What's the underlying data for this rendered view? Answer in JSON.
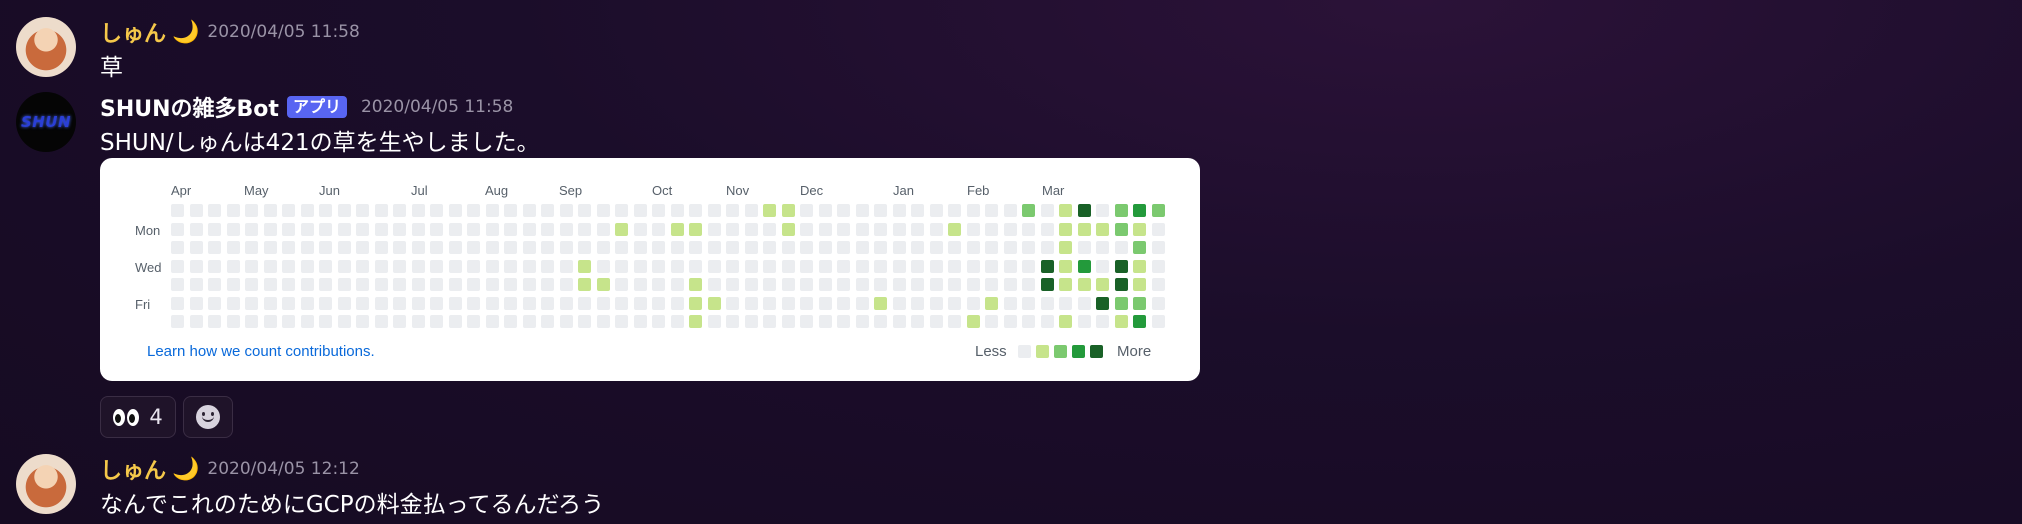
{
  "messages": [
    {
      "username": "しゅん",
      "moon": "🌙",
      "timestamp": "2020/04/05 11:58",
      "text": "草"
    },
    {
      "username": "SHUNの雑多Bot",
      "badge": "アプリ",
      "avatar_text": "SHUN",
      "timestamp": "2020/04/05 11:58",
      "text": "SHUN/しゅんは421の草を生やしました。"
    },
    {
      "username": "しゅん",
      "moon": "🌙",
      "timestamp": "2020/04/05 12:12",
      "text": "なんでこれのためにGCPの料金払ってるんだろう"
    }
  ],
  "contribution_graph": {
    "months": [
      "Apr",
      "May",
      "Jun",
      "Jul",
      "Aug",
      "Sep",
      "Oct",
      "Nov",
      "Dec",
      "Jan",
      "Feb",
      "Mar"
    ],
    "day_labels": [
      "Mon",
      "Wed",
      "Fri"
    ],
    "learn_link": "Learn how we count contributions.",
    "legend_less": "Less",
    "legend_more": "More",
    "colors": [
      "#ebedf0",
      "#c6e48b",
      "#7bc96f",
      "#239a3b",
      "#196127"
    ],
    "levels": [
      [
        0,
        0,
        0,
        0,
        0,
        0,
        0,
        0,
        0,
        0,
        0,
        0,
        0,
        0,
        0,
        0,
        0,
        0,
        0,
        0,
        0,
        0,
        0,
        0,
        0,
        0,
        0,
        0,
        0,
        0,
        0,
        0,
        1,
        1,
        0,
        0,
        0,
        0,
        0,
        0,
        0,
        0,
        0,
        0,
        0,
        0,
        2,
        0,
        1,
        4,
        0,
        2,
        3,
        2
      ],
      [
        0,
        0,
        0,
        0,
        0,
        0,
        0,
        0,
        0,
        0,
        0,
        0,
        0,
        0,
        0,
        0,
        0,
        0,
        0,
        0,
        0,
        0,
        0,
        0,
        1,
        0,
        0,
        1,
        1,
        0,
        0,
        0,
        0,
        1,
        0,
        0,
        0,
        0,
        0,
        0,
        0,
        0,
        1,
        0,
        0,
        0,
        0,
        0,
        1,
        1,
        1,
        2,
        1,
        0
      ],
      [
        0,
        0,
        0,
        0,
        0,
        0,
        0,
        0,
        0,
        0,
        0,
        0,
        0,
        0,
        0,
        0,
        0,
        0,
        0,
        0,
        0,
        0,
        0,
        0,
        0,
        0,
        0,
        0,
        0,
        0,
        0,
        0,
        0,
        0,
        0,
        0,
        0,
        0,
        0,
        0,
        0,
        0,
        0,
        0,
        0,
        0,
        0,
        0,
        1,
        0,
        0,
        0,
        2,
        0
      ],
      [
        0,
        0,
        0,
        0,
        0,
        0,
        0,
        0,
        0,
        0,
        0,
        0,
        0,
        0,
        0,
        0,
        0,
        0,
        0,
        0,
        0,
        0,
        1,
        0,
        0,
        0,
        0,
        0,
        0,
        0,
        0,
        0,
        0,
        0,
        0,
        0,
        0,
        0,
        0,
        0,
        0,
        0,
        0,
        0,
        0,
        0,
        0,
        4,
        1,
        3,
        0,
        4,
        1,
        0
      ],
      [
        0,
        0,
        0,
        0,
        0,
        0,
        0,
        0,
        0,
        0,
        0,
        0,
        0,
        0,
        0,
        0,
        0,
        0,
        0,
        0,
        0,
        0,
        1,
        1,
        0,
        0,
        0,
        0,
        1,
        0,
        0,
        0,
        0,
        0,
        0,
        0,
        0,
        0,
        0,
        0,
        0,
        0,
        0,
        0,
        0,
        0,
        0,
        4,
        1,
        1,
        1,
        4,
        1,
        0
      ],
      [
        0,
        0,
        0,
        0,
        0,
        0,
        0,
        0,
        0,
        0,
        0,
        0,
        0,
        0,
        0,
        0,
        0,
        0,
        0,
        0,
        0,
        0,
        0,
        0,
        0,
        0,
        0,
        0,
        1,
        1,
        0,
        0,
        0,
        0,
        0,
        0,
        0,
        0,
        1,
        0,
        0,
        0,
        0,
        0,
        1,
        0,
        0,
        0,
        0,
        0,
        4,
        2,
        2,
        0
      ],
      [
        0,
        0,
        0,
        0,
        0,
        0,
        0,
        0,
        0,
        0,
        0,
        0,
        0,
        0,
        0,
        0,
        0,
        0,
        0,
        0,
        0,
        0,
        0,
        0,
        0,
        0,
        0,
        0,
        1,
        0,
        0,
        0,
        0,
        0,
        0,
        0,
        0,
        0,
        0,
        0,
        0,
        0,
        0,
        1,
        0,
        0,
        0,
        0,
        1,
        0,
        0,
        1,
        3,
        0
      ]
    ]
  },
  "reactions": [
    {
      "emoji": "eyes-emoji",
      "count": "4"
    }
  ]
}
